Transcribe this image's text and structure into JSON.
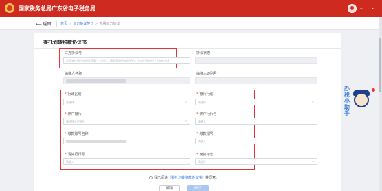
{
  "header": {
    "title": "国家税务总局广东省电子税务局",
    "user_name": "...",
    "chevron": "⌄"
  },
  "subbar": {
    "back_label": "返回",
    "breadcrumb": [
      "首页",
      "三方协议签订",
      "签署三方协议"
    ],
    "sep": ">"
  },
  "card": {
    "title": "委托划转税款协议书"
  },
  "form": {
    "agreement_no": {
      "label": "三方协议号",
      "placeholder": "若您未在银行办理过签署三方协议，请先到银行办理签约，完成后再进行三方协议信息录入"
    },
    "agreement_status": {
      "label": "协议状态"
    },
    "taxpayer_name": {
      "label": "纳税人名称"
    },
    "taxpayer_id": {
      "label": "纳税人识别号"
    },
    "admin_region": {
      "label": "行政区划",
      "placeholder": "请选择"
    },
    "bank_category": {
      "label": "银行行别",
      "placeholder": "请选择"
    },
    "open_bank": {
      "label": "开户银行",
      "placeholder": "请选择开户银行"
    },
    "open_bank_no": {
      "label": "开户行行号",
      "placeholder": "请输入"
    },
    "account_name": {
      "label": "缴款账号名称"
    },
    "account_no": {
      "label": "缴款账号",
      "placeholder": "请输入"
    },
    "clearing_bank": {
      "label": "清算行行号",
      "placeholder": "请输入"
    },
    "gov_bank_flag": {
      "label": "免扣标志",
      "placeholder": "请选择"
    }
  },
  "agreement": {
    "prefix": "我已阅读",
    "link": "《委托划转税款协议书》",
    "suffix": "并同意。"
  },
  "buttons": {
    "cancel": "取消",
    "submit": "提交"
  },
  "assistant": {
    "text": "办税小助手",
    "status_color": "#e33333"
  },
  "colors": {
    "brand_red": "#cf2a20",
    "link_blue": "#3b7ddd",
    "highlight_red": "#e0333a"
  }
}
